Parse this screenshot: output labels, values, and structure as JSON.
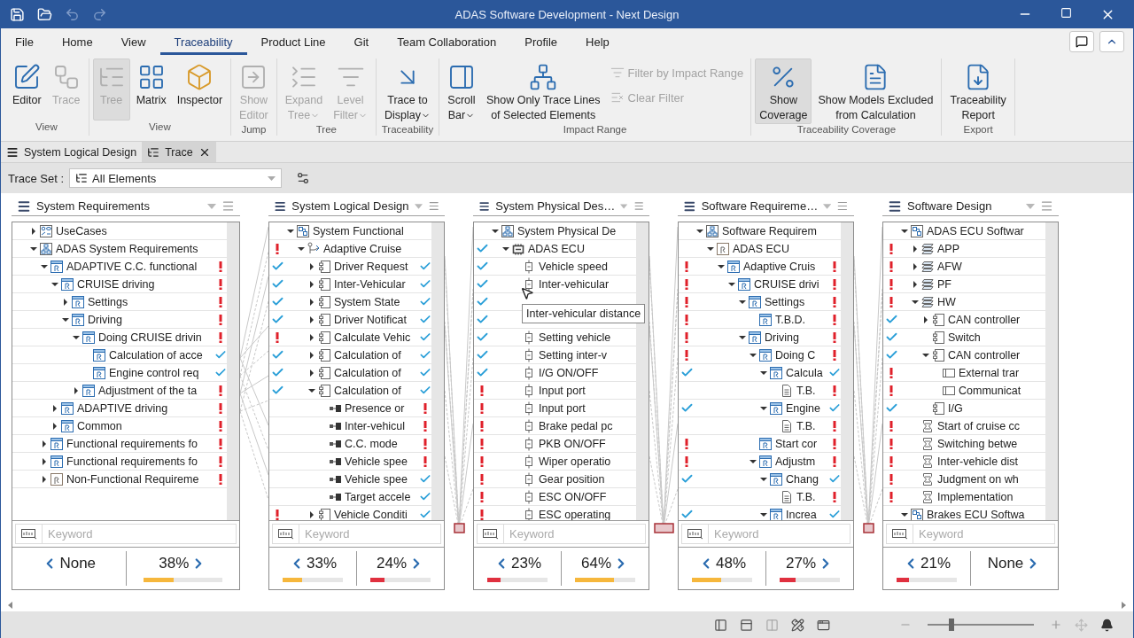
{
  "window": {
    "title": "ADAS Software Development - Next Design"
  },
  "menu": [
    {
      "label": "File",
      "selected": false
    },
    {
      "label": "Home",
      "selected": false
    },
    {
      "label": "View",
      "selected": false
    },
    {
      "label": "Traceability",
      "selected": true
    },
    {
      "label": "Product Line",
      "selected": false
    },
    {
      "label": "Git",
      "selected": false
    },
    {
      "label": "Team Collaboration",
      "selected": false
    },
    {
      "label": "Profile",
      "selected": false
    },
    {
      "label": "Help",
      "selected": false
    }
  ],
  "ribbon": [
    {
      "label": "View",
      "items": [
        {
          "kind": "large",
          "lines": [
            "Editor"
          ],
          "disabled": false,
          "pressed": false
        },
        {
          "kind": "large",
          "lines": [
            "Trace"
          ],
          "disabled": true,
          "pressed": false
        }
      ]
    },
    {
      "label": "View",
      "items": [
        {
          "kind": "large",
          "lines": [
            "Tree"
          ],
          "disabled": true,
          "pressed": true
        },
        {
          "kind": "large",
          "lines": [
            "Matrix"
          ],
          "disabled": false,
          "pressed": false
        },
        {
          "kind": "large",
          "lines": [
            "Inspector"
          ],
          "disabled": false,
          "pressed": false
        }
      ]
    },
    {
      "label": "Jump",
      "items": [
        {
          "kind": "large",
          "lines": [
            "Show",
            "Editor"
          ],
          "disabled": true,
          "pressed": false
        }
      ]
    },
    {
      "label": "Tree",
      "items": [
        {
          "kind": "large",
          "lines": [
            "Expand",
            "Tree"
          ],
          "disabled": true,
          "pressed": false,
          "dropdown": true
        },
        {
          "kind": "large",
          "lines": [
            "Level",
            "Filter"
          ],
          "disabled": true,
          "pressed": false,
          "dropdown": true
        }
      ]
    },
    {
      "label": "Traceability",
      "items": [
        {
          "kind": "large",
          "lines": [
            "Trace to",
            "Display"
          ],
          "disabled": false,
          "pressed": false,
          "dropdown": true
        }
      ]
    },
    {
      "label": "Impact Range",
      "items": [
        {
          "kind": "large",
          "lines": [
            "Scroll",
            "Bar"
          ],
          "disabled": false,
          "pressed": false,
          "dropdown": true
        },
        {
          "kind": "large",
          "lines": [
            "Show Only Trace Lines",
            "of Selected Elements"
          ],
          "disabled": false,
          "pressed": false
        },
        {
          "kind": "small",
          "lines": [
            "Filter by Impact Range"
          ],
          "disabled": true
        },
        {
          "kind": "small",
          "lines": [
            "Clear Filter"
          ],
          "disabled": true
        }
      ]
    },
    {
      "label": "Traceability Coverage",
      "items": [
        {
          "kind": "large",
          "lines": [
            "Show",
            "Coverage"
          ],
          "disabled": false,
          "pressed": true
        },
        {
          "kind": "large",
          "lines": [
            "Show Models Excluded",
            "from Calculation"
          ],
          "disabled": false,
          "pressed": false
        }
      ]
    },
    {
      "label": "Export",
      "items": [
        {
          "kind": "large",
          "lines": [
            "Traceability",
            "Report"
          ],
          "disabled": false,
          "pressed": false
        }
      ]
    }
  ],
  "doc_tabs": [
    {
      "label": "System Logical Design",
      "selected": false
    },
    {
      "label": "Trace",
      "selected": true
    }
  ],
  "trace_set": {
    "label": "Trace Set :",
    "value": "All Elements"
  },
  "panels": [
    {
      "title": "System Requirements",
      "rows": [
        {
          "text": "UseCases",
          "kind": "usecase",
          "expanded": false
        },
        {
          "text": "ADAS System Requirements",
          "kind": "package",
          "expanded": true,
          "children": [
            {
              "text": "ADAPTIVE C.C. functional",
              "kind": "req",
              "right_ok": false,
              "expanded": true,
              "children": [
                {
                  "text": "CRUISE driving",
                  "kind": "req",
                  "right_ok": false,
                  "expanded": true,
                  "children": [
                    {
                      "text": "Settings",
                      "kind": "req",
                      "right_ok": false,
                      "expanded": false
                    },
                    {
                      "text": "Driving",
                      "kind": "req",
                      "right_ok": false,
                      "expanded": true,
                      "children": [
                        {
                          "text": "Doing CRUISE drivin",
                          "kind": "req",
                          "right_ok": false,
                          "expanded": true,
                          "children": [
                            {
                              "text": "Calculation of acce",
                              "kind": "req",
                              "right_ok": true
                            },
                            {
                              "text": "Engine control req",
                              "kind": "req",
                              "right_ok": true
                            }
                          ]
                        },
                        {
                          "text": "Adjustment of the ta",
                          "kind": "req",
                          "right_ok": false,
                          "expanded": false
                        }
                      ]
                    }
                  ]
                },
                {
                  "text": "ADAPTIVE driving",
                  "kind": "req",
                  "right_ok": false,
                  "expanded": false
                },
                {
                  "text": "Common",
                  "kind": "req",
                  "right_ok": false,
                  "expanded": false
                }
              ]
            },
            {
              "text": "Functional requirements fo",
              "kind": "req",
              "right_ok": false,
              "expanded": false
            },
            {
              "text": "Functional requirements fo",
              "kind": "req",
              "right_ok": false,
              "expanded": false
            },
            {
              "text": "Non-Functional Requireme",
              "kind": "req_grey",
              "right_ok": false,
              "expanded": false
            }
          ]
        }
      ],
      "keyword_placeholder": "Keyword",
      "coverage": [
        {
          "value": "None"
        },
        {
          "value": "38%",
          "level": 0.38,
          "color": "#f6b73c"
        }
      ]
    },
    {
      "title": "System Logical Design",
      "rows": [
        {
          "text": "System Functional",
          "kind": "model",
          "expanded": true,
          "children": [
            {
              "text": "Adaptive Cruise",
              "kind": "flow",
              "left_ok": false,
              "expanded": true,
              "children": [
                {
                  "text": "Driver Request",
                  "kind": "block",
                  "left_ok": true,
                  "right_ok": true,
                  "expanded": false
                },
                {
                  "text": "Inter-Vehicular",
                  "kind": "block",
                  "left_ok": true,
                  "right_ok": true,
                  "expanded": false
                },
                {
                  "text": "System State",
                  "kind": "block",
                  "left_ok": true,
                  "right_ok": true,
                  "expanded": false
                },
                {
                  "text": "Driver Notificat",
                  "kind": "block",
                  "left_ok": true,
                  "right_ok": true,
                  "expanded": false
                },
                {
                  "text": "Calculate Vehic",
                  "kind": "block",
                  "left_ok": false,
                  "right_ok": true,
                  "expanded": false
                },
                {
                  "text": "Calculation of",
                  "kind": "block",
                  "left_ok": true,
                  "right_ok": true,
                  "expanded": false
                },
                {
                  "text": "Calculation of",
                  "kind": "block",
                  "left_ok": true,
                  "right_ok": true,
                  "expanded": false
                },
                {
                  "text": "Calculation of",
                  "kind": "block",
                  "left_ok": true,
                  "right_ok": true,
                  "expanded": true,
                  "children": [
                    {
                      "text": "Presence or",
                      "kind": "port",
                      "right_ok": false
                    },
                    {
                      "text": "Inter-vehicul",
                      "kind": "port",
                      "right_ok": false
                    },
                    {
                      "text": "C.C. mode",
                      "kind": "port",
                      "right_ok": false
                    },
                    {
                      "text": "Vehicle spee",
                      "kind": "port",
                      "right_ok": false
                    },
                    {
                      "text": "Vehicle spee",
                      "kind": "port",
                      "right_ok": true
                    },
                    {
                      "text": "Target accele",
                      "kind": "port",
                      "right_ok": true
                    }
                  ]
                },
                {
                  "text": "Vehicle Conditi",
                  "kind": "block",
                  "left_ok": false,
                  "right_ok": true,
                  "expanded": false
                }
              ]
            }
          ]
        }
      ],
      "keyword_placeholder": "Keyword",
      "coverage": [
        {
          "value": "33%",
          "level": 0.33,
          "color": "#f6b73c"
        },
        {
          "value": "24%",
          "level": 0.24,
          "color": "#e0303f"
        }
      ]
    },
    {
      "title": "System Physical Des…",
      "tooltip": "Inter-vehicular distance",
      "rows": [
        {
          "text": "System Physical De",
          "kind": "package",
          "expanded": true,
          "children": [
            {
              "text": "ADAS ECU",
              "kind": "ecu",
              "left_ok": true,
              "expanded": true,
              "children": [
                {
                  "text": "Vehicle speed",
                  "kind": "pin",
                  "left_ok": true
                },
                {
                  "text": "Inter-vehicular",
                  "kind": "pin",
                  "left_ok": true
                },
                {
                  "left_ok": true
                },
                {
                  "left_ok": true
                },
                {
                  "text": "Setting vehicle",
                  "kind": "pin",
                  "left_ok": true
                },
                {
                  "text": "Setting inter-v",
                  "kind": "pin",
                  "left_ok": true
                },
                {
                  "text": "I/G ON/OFF",
                  "kind": "pin",
                  "left_ok": true
                },
                {
                  "text": "Input port",
                  "kind": "pin",
                  "left_ok": false
                },
                {
                  "text": "Input port",
                  "kind": "pin",
                  "left_ok": false
                },
                {
                  "text": "Brake pedal pc",
                  "kind": "pin",
                  "left_ok": false
                },
                {
                  "text": "PKB  ON/OFF",
                  "kind": "pin",
                  "left_ok": false
                },
                {
                  "text": "Wiper operatio",
                  "kind": "pin",
                  "left_ok": false
                },
                {
                  "text": "Gear position",
                  "kind": "pin",
                  "left_ok": false
                },
                {
                  "text": "ESC ON/OFF",
                  "kind": "pin",
                  "left_ok": false
                },
                {
                  "text": "ESC operating",
                  "kind": "pin",
                  "left_ok": false
                }
              ]
            }
          ]
        }
      ],
      "keyword_placeholder": "Keyword",
      "coverage": [
        {
          "value": "23%",
          "level": 0.23,
          "color": "#e0303f"
        },
        {
          "value": "64%",
          "level": 0.64,
          "color": "#f6b73c"
        }
      ]
    },
    {
      "title": "Software Requireme…",
      "rows": [
        {
          "text": "Software Requirem",
          "kind": "package",
          "expanded": true,
          "children": [
            {
              "text": "ADAS  ECU",
              "kind": "req_grey",
              "expanded": true,
              "children": [
                {
                  "text": "Adaptive Cruis",
                  "kind": "req",
                  "left_ok": false,
                  "right_ok": false,
                  "expanded": true,
                  "children": [
                    {
                      "text": "CRUISE drivi",
                      "kind": "req",
                      "left_ok": false,
                      "right_ok": false,
                      "expanded": true,
                      "children": [
                        {
                          "text": "Settings",
                          "kind": "req",
                          "left_ok": false,
                          "right_ok": false,
                          "expanded": true,
                          "children": [
                            {
                              "text": "T.B.D.",
                              "kind": "req",
                              "left_ok": false,
                              "right_ok": false
                            }
                          ]
                        },
                        {
                          "text": "Driving",
                          "kind": "req",
                          "left_ok": false,
                          "right_ok": false,
                          "expanded": true,
                          "children": [
                            {
                              "text": "Doing C",
                              "kind": "req",
                              "left_ok": false,
                              "right_ok": false,
                              "expanded": true,
                              "children": [
                                {
                                  "text": "Calcula",
                                  "kind": "req",
                                  "left_ok": true,
                                  "right_ok": true,
                                  "expanded": true,
                                  "children": [
                                    {
                                      "text": "T.B.",
                                      "kind": "doc",
                                      "right_ok": false
                                    }
                                  ]
                                },
                                {
                                  "text": "Engine",
                                  "kind": "req",
                                  "left_ok": true,
                                  "right_ok": true,
                                  "expanded": true,
                                  "children": [
                                    {
                                      "text": "T.B.",
                                      "kind": "doc",
                                      "right_ok": false
                                    }
                                  ]
                                }
                              ]
                            },
                            {
                              "text": "Start cor",
                              "kind": "req",
                              "left_ok": false,
                              "right_ok": false
                            },
                            {
                              "text": "Adjustm",
                              "kind": "req",
                              "left_ok": false,
                              "right_ok": false,
                              "expanded": true,
                              "children": [
                                {
                                  "text": "Chang",
                                  "kind": "req",
                                  "left_ok": true,
                                  "right_ok": true,
                                  "expanded": true,
                                  "children": [
                                    {
                                      "text": "T.B.",
                                      "kind": "doc",
                                      "right_ok": false
                                    }
                                  ]
                                },
                                {
                                  "text": "Increa",
                                  "kind": "req",
                                  "left_ok": true,
                                  "right_ok": true,
                                  "expanded": true
                                }
                              ]
                            }
                          ]
                        }
                      ]
                    }
                  ]
                }
              ]
            }
          ]
        }
      ],
      "keyword_placeholder": "Keyword",
      "coverage": [
        {
          "value": "48%",
          "level": 0.48,
          "color": "#f6b73c"
        },
        {
          "value": "27%",
          "level": 0.27,
          "color": "#e0303f"
        }
      ]
    },
    {
      "title": "Software Design",
      "rows": [
        {
          "text": "ADAS ECU Softwar",
          "kind": "model",
          "expanded": true,
          "children": [
            {
              "text": "APP",
              "kind": "layer",
              "left_ok": false,
              "expanded": false
            },
            {
              "text": "AFW",
              "kind": "layer",
              "left_ok": false,
              "expanded": false
            },
            {
              "text": "PF",
              "kind": "layer",
              "left_ok": false,
              "expanded": false
            },
            {
              "text": "HW",
              "kind": "layer",
              "left_ok": false,
              "expanded": true,
              "children": [
                {
                  "text": "CAN controller",
                  "kind": "block",
                  "left_ok": true,
                  "expanded": false
                },
                {
                  "text": "Switch",
                  "kind": "block",
                  "left_ok": true
                },
                {
                  "text": "CAN controller",
                  "kind": "block",
                  "left_ok": true,
                  "expanded": true,
                  "children": [
                    {
                      "text": "External trar",
                      "kind": "iface",
                      "left_ok": false
                    },
                    {
                      "text": "Communicat",
                      "kind": "iface",
                      "left_ok": false
                    }
                  ]
                },
                {
                  "text": "I/G",
                  "kind": "block",
                  "left_ok": true
                }
              ]
            },
            {
              "text": "Start of cruise cc",
              "kind": "spec",
              "left_ok": false
            },
            {
              "text": "Switching betwe",
              "kind": "spec",
              "left_ok": false
            },
            {
              "text": "Inter-vehicle dist",
              "kind": "spec",
              "left_ok": false
            },
            {
              "text": "Judgment on wh",
              "kind": "spec",
              "left_ok": false
            },
            {
              "text": "Implementation",
              "kind": "spec",
              "left_ok": false
            }
          ]
        },
        {
          "text": "Brakes ECU Softwa",
          "kind": "model",
          "expanded": true
        }
      ],
      "keyword_placeholder": "Keyword",
      "coverage": [
        {
          "value": "21%",
          "level": 0.21,
          "color": "#e0303f"
        },
        {
          "value": "None"
        }
      ]
    }
  ],
  "status_bar": {
    "zoom": {
      "level": 0.2
    }
  }
}
